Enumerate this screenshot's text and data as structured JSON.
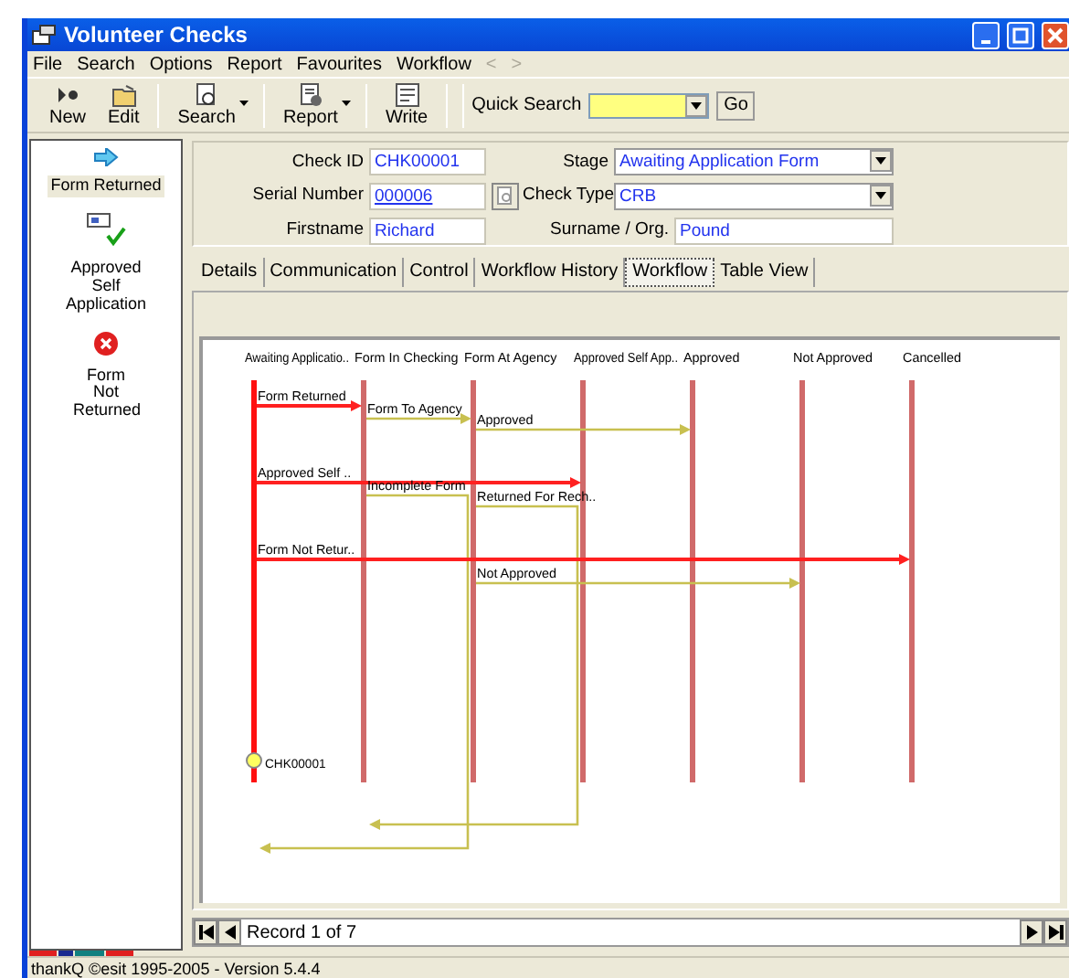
{
  "window": {
    "title": "Volunteer Checks"
  },
  "menu": [
    "File",
    "Search",
    "Options",
    "Report",
    "Favourites",
    "Workflow",
    "<",
    ">"
  ],
  "toolbar": [
    {
      "label": "New",
      "kind": "new",
      "dropdown": false
    },
    {
      "label": "Edit",
      "kind": "edit",
      "dropdown": false
    },
    {
      "label": "Search",
      "kind": "search",
      "dropdown": true
    },
    {
      "label": "Report",
      "kind": "report",
      "dropdown": true
    },
    {
      "label": "Write",
      "kind": "write",
      "dropdown": false
    }
  ],
  "quick_search": {
    "label": "Quick Search",
    "button": "Go"
  },
  "actions": [
    {
      "label": "Form Returned",
      "kind": "forward",
      "selected": true
    },
    {
      "label": "Approved Self Application",
      "kind": "approve",
      "selected": false
    },
    {
      "label": "Form Not Returned",
      "kind": "reject",
      "selected": false
    }
  ],
  "fields": {
    "check_id": {
      "label": "Check ID",
      "value": "CHK00001"
    },
    "serial_number": {
      "label": "Serial Number",
      "value": "000006"
    },
    "firstname": {
      "label": "Firstname",
      "value": "Richard"
    },
    "stage": {
      "label": "Stage",
      "value": "Awaiting Application Form"
    },
    "check_type": {
      "label": "Check Type",
      "value": "CRB"
    },
    "surname": {
      "label": "Surname / Org.",
      "value": "Pound"
    }
  },
  "tabs": [
    {
      "label": "Details",
      "selected": false
    },
    {
      "label": "Communication",
      "selected": false
    },
    {
      "label": "Control",
      "selected": false
    },
    {
      "label": "Workflow History",
      "selected": false
    },
    {
      "label": "Workflow",
      "selected": true
    },
    {
      "label": "Table View",
      "selected": false
    }
  ],
  "diagram": {
    "states": [
      {
        "label": "Awaiting Applicatio..",
        "current": true
      },
      {
        "label": "Form In Checking",
        "current": false
      },
      {
        "label": "Form At Agency",
        "current": false
      },
      {
        "label": "Approved Self App..",
        "current": false
      },
      {
        "label": "Approved",
        "current": false
      },
      {
        "label": "Not Approved",
        "current": false
      },
      {
        "label": "Cancelled",
        "current": false
      }
    ],
    "transitions": [
      {
        "label": "Form Returned",
        "active": true
      },
      {
        "label": "Form To Agency",
        "active": false
      },
      {
        "label": "Approved",
        "active": false
      },
      {
        "label": "Approved Self ..",
        "active": true
      },
      {
        "label": "Incomplete Form",
        "active": false
      },
      {
        "label": "Returned For Rech..",
        "active": false
      },
      {
        "label": "Form Not Retur..",
        "active": true
      },
      {
        "label": "Not Approved",
        "active": false
      }
    ],
    "marker": "CHK00001"
  },
  "navigator": {
    "text": "Record 1 of 7"
  },
  "status_bar": "thankQ ©esit 1995-2005 - Version 5.4.4"
}
